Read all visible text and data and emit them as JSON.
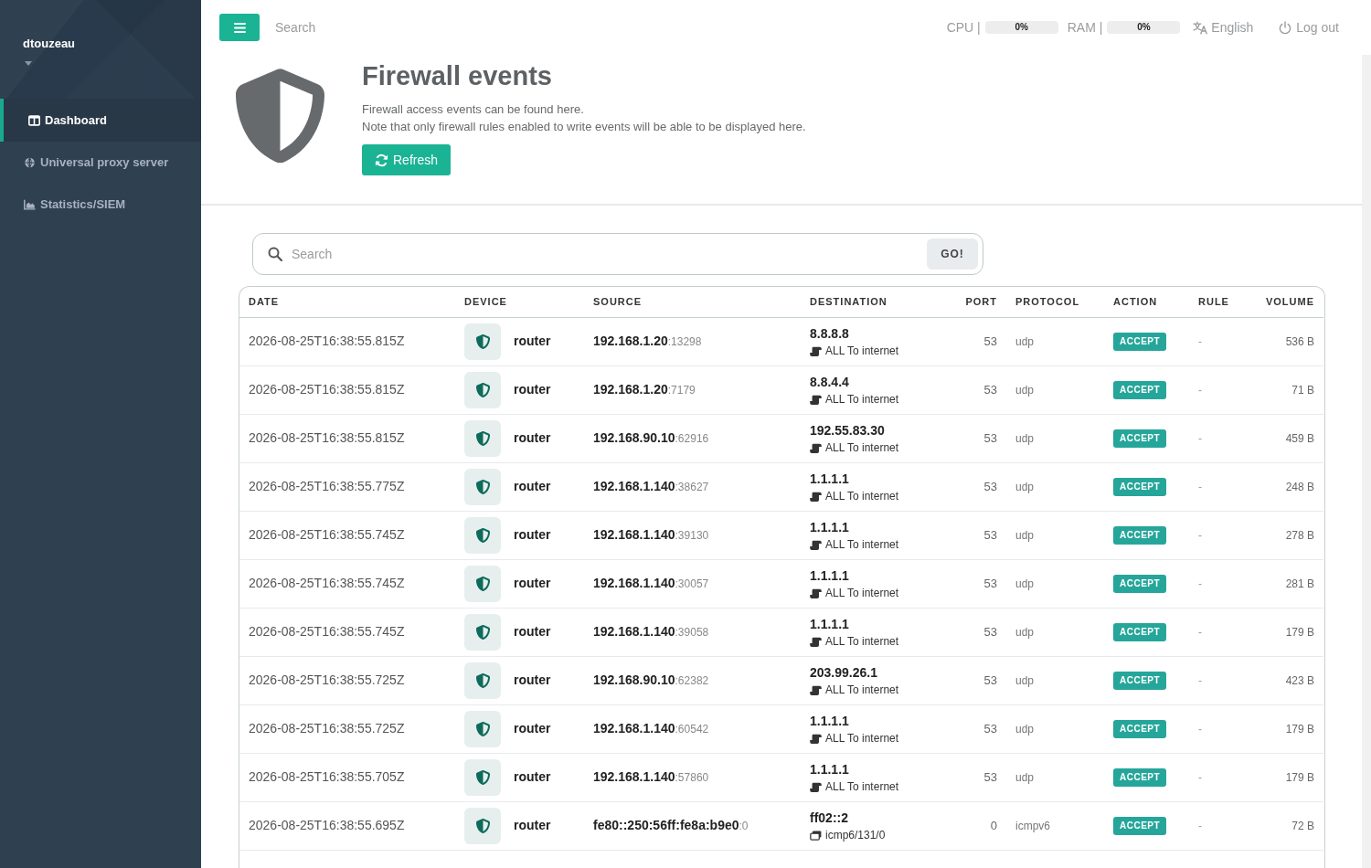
{
  "sidebar": {
    "user": "dtouzeau",
    "items": [
      {
        "label": "Dashboard",
        "selected": true
      },
      {
        "label": "Universal proxy server",
        "selected": false
      },
      {
        "label": "Statistics/SIEM",
        "selected": false
      }
    ]
  },
  "topbar": {
    "search": {
      "placeholder": "Search"
    },
    "meters": [
      {
        "label": "CPU |",
        "level": 0,
        "reading": "0%"
      },
      {
        "label": "RAM |",
        "level": 0,
        "reading": "0%"
      }
    ],
    "language": "English",
    "logout": "Log out"
  },
  "header": {
    "title": "Firewall events",
    "lines": [
      "Firewall access events can be found here.",
      "Note that only firewall rules enabled to write events will be able to be displayed here."
    ],
    "button": "Refresh"
  },
  "filter": {
    "placeholder": "Search",
    "button": "GO!"
  },
  "table": {
    "columns": [
      "DATE",
      "DEVICE",
      "SOURCE",
      "DESTINATION",
      "PORT",
      "PROTOCOL",
      "ACTION",
      "RULE",
      "VOLUME"
    ],
    "rows": [
      {
        "date": "2026-08-25T16:38:55.815Z",
        "device": "router",
        "source": "**192.168.1.20**:13298",
        "destination": "8.8.8.8",
        "detail": {
          "kind": "rule",
          "text": "ALL To internet"
        },
        "port": "53",
        "protocol": "udp",
        "action": "ACCEPT",
        "rule": "-",
        "volume": "536 B"
      },
      {
        "date": "2026-08-25T16:38:55.815Z",
        "device": "router",
        "source": "**192.168.1.20**:7179",
        "destination": "8.8.4.4",
        "detail": {
          "kind": "rule",
          "text": "ALL To internet"
        },
        "port": "53",
        "protocol": "udp",
        "action": "ACCEPT",
        "rule": "-",
        "volume": "71 B"
      },
      {
        "date": "2026-08-25T16:38:55.815Z",
        "device": "router",
        "source": "**192.168.90.10**:62916",
        "destination": "192.55.83.30",
        "detail": {
          "kind": "rule",
          "text": "ALL To internet"
        },
        "port": "53",
        "protocol": "udp",
        "action": "ACCEPT",
        "rule": "-",
        "volume": "459 B"
      },
      {
        "date": "2026-08-25T16:38:55.775Z",
        "device": "router",
        "source": "**192.168.1.140**:38627",
        "destination": "1.1.1.1",
        "detail": {
          "kind": "rule",
          "text": "ALL To internet"
        },
        "port": "53",
        "protocol": "udp",
        "action": "ACCEPT",
        "rule": "-",
        "volume": "248 B"
      },
      {
        "date": "2026-08-25T16:38:55.745Z",
        "device": "router",
        "source": "**192.168.1.140**:39130",
        "destination": "1.1.1.1",
        "detail": {
          "kind": "rule",
          "text": "ALL To internet"
        },
        "port": "53",
        "protocol": "udp",
        "action": "ACCEPT",
        "rule": "-",
        "volume": "278 B"
      },
      {
        "date": "2026-08-25T16:38:55.745Z",
        "device": "router",
        "source": "**192.168.1.140**:30057",
        "destination": "1.1.1.1",
        "detail": {
          "kind": "rule",
          "text": "ALL To internet"
        },
        "port": "53",
        "protocol": "udp",
        "action": "ACCEPT",
        "rule": "-",
        "volume": "281 B"
      },
      {
        "date": "2026-08-25T16:38:55.745Z",
        "device": "router",
        "source": "**192.168.1.140**:39058",
        "destination": "1.1.1.1",
        "detail": {
          "kind": "rule",
          "text": "ALL To internet"
        },
        "port": "53",
        "protocol": "udp",
        "action": "ACCEPT",
        "rule": "-",
        "volume": "179 B"
      },
      {
        "date": "2026-08-25T16:38:55.725Z",
        "device": "router",
        "source": "**192.168.90.10**:62382",
        "destination": "203.99.26.1",
        "detail": {
          "kind": "rule",
          "text": "ALL To internet"
        },
        "port": "53",
        "protocol": "udp",
        "action": "ACCEPT",
        "rule": "-",
        "volume": "423 B"
      },
      {
        "date": "2026-08-25T16:38:55.725Z",
        "device": "router",
        "source": "**192.168.1.140**:60542",
        "destination": "1.1.1.1",
        "detail": {
          "kind": "rule",
          "text": "ALL To internet"
        },
        "port": "53",
        "protocol": "udp",
        "action": "ACCEPT",
        "rule": "-",
        "volume": "179 B"
      },
      {
        "date": "2026-08-25T16:38:55.705Z",
        "device": "router",
        "source": "**192.168.1.140**:57860",
        "destination": "1.1.1.1",
        "detail": {
          "kind": "rule",
          "text": "ALL To internet"
        },
        "port": "53",
        "protocol": "udp",
        "action": "ACCEPT",
        "rule": "-",
        "volume": "179 B"
      },
      {
        "date": "2026-08-25T16:38:55.695Z",
        "device": "router",
        "source": "**fe80::250:56ff:fe8a:b9e0**:0",
        "destination": "ff02::2",
        "detail": {
          "kind": "icmp",
          "text": "icmp6/131/0"
        },
        "port": "0",
        "protocol": "icmpv6",
        "action": "ACCEPT",
        "rule": "-",
        "volume": "72 B"
      }
    ]
  }
}
